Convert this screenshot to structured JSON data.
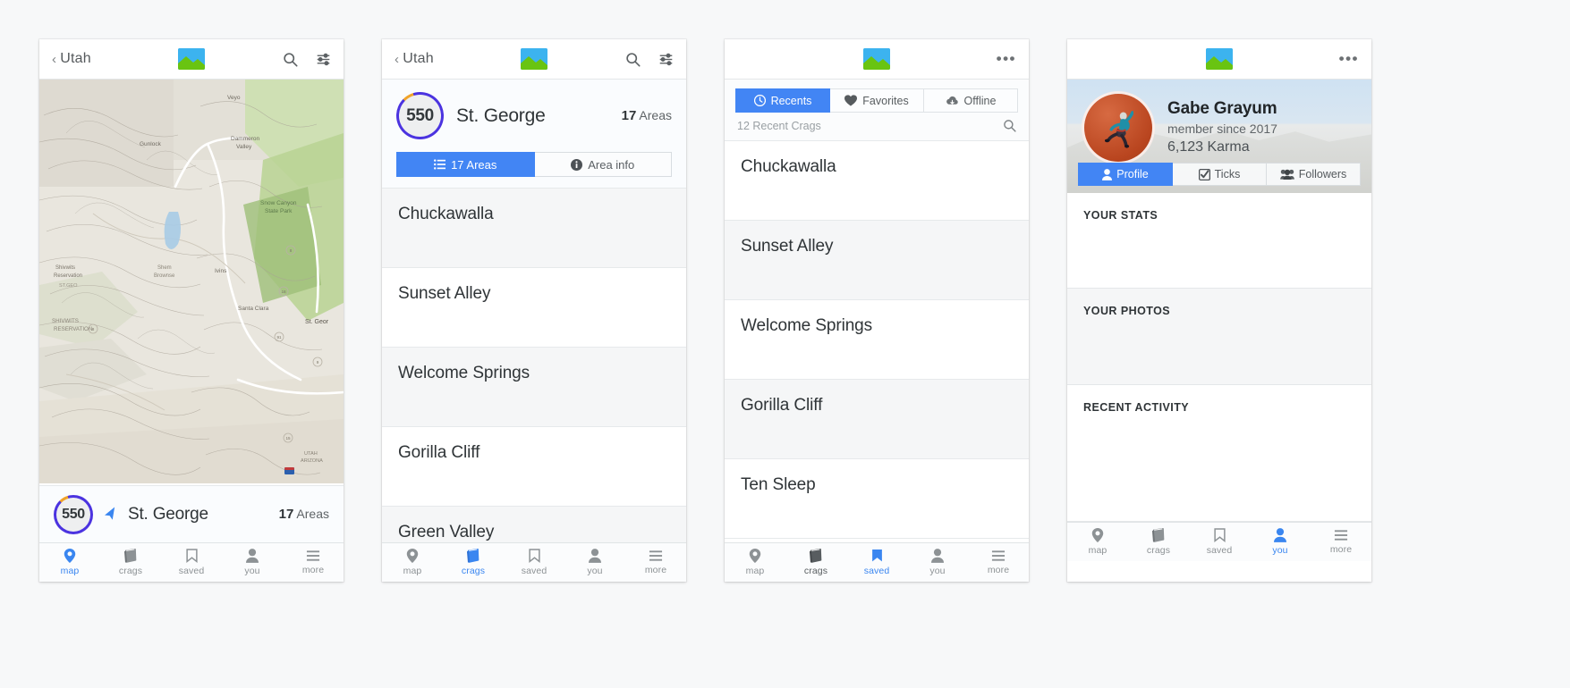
{
  "app": {
    "logo_name": "mountain-logo"
  },
  "panel_map": {
    "nav": {
      "back_label": "Utah",
      "search_icon": "search-icon",
      "filter_icon": "sliders-icon"
    },
    "map": {
      "labels": [
        "Veyo",
        "Dammeron Valley",
        "Gunlock",
        "Snow Canyon State Park",
        "Shivwits Reservation",
        "Ivins",
        "Santa Clara",
        "St. George",
        "UTAH",
        "ARIZONA"
      ]
    },
    "card": {
      "score": "550",
      "title": "St. George",
      "count": "17",
      "count_label": "Areas",
      "location_icon": "location-arrow-icon"
    },
    "tabs": [
      {
        "label": "map",
        "icon": "map-pin-icon",
        "active": true
      },
      {
        "label": "crags",
        "icon": "book-icon",
        "active": false
      },
      {
        "label": "saved",
        "icon": "bookmark-icon",
        "active": false
      },
      {
        "label": "you",
        "icon": "person-icon",
        "active": false
      },
      {
        "label": "more",
        "icon": "hamburger-icon",
        "active": false
      }
    ]
  },
  "panel_area": {
    "nav": {
      "back_label": "Utah",
      "search_icon": "search-icon",
      "filter_icon": "sliders-icon"
    },
    "header": {
      "score": "550",
      "title": "St. George",
      "count": "17",
      "count_label": "Areas"
    },
    "segments": [
      {
        "label": "17 Areas",
        "icon": "list-icon",
        "active": true
      },
      {
        "label": "Area info",
        "icon": "info-icon",
        "active": false
      }
    ],
    "list": [
      "Chuckawalla",
      "Sunset Alley",
      "Welcome Springs",
      "Gorilla Cliff",
      "Green Valley"
    ],
    "tabs": [
      {
        "label": "map",
        "icon": "map-pin-icon",
        "active": false
      },
      {
        "label": "crags",
        "icon": "book-icon",
        "active": true
      },
      {
        "label": "saved",
        "icon": "bookmark-icon",
        "active": false
      },
      {
        "label": "you",
        "icon": "person-icon",
        "active": false
      },
      {
        "label": "more",
        "icon": "hamburger-icon",
        "active": false
      }
    ]
  },
  "panel_saved": {
    "nav": {
      "menu_icon": "more-dots-icon"
    },
    "tabs": [
      {
        "label": "Recents",
        "icon": "clock-icon",
        "active": true
      },
      {
        "label": "Favorites",
        "icon": "heart-icon",
        "active": false
      },
      {
        "label": "Offline",
        "icon": "cloud-download-icon",
        "active": false
      }
    ],
    "search": {
      "value": "12 Recent Crags",
      "placeholder": "12 Recent Crags",
      "icon": "search-icon"
    },
    "list": [
      "Chuckawalla",
      "Sunset Alley",
      "Welcome Springs",
      "Gorilla Cliff",
      "Ten Sleep"
    ],
    "bottom_tabs": [
      {
        "label": "map",
        "icon": "map-pin-icon",
        "active": false
      },
      {
        "label": "crags",
        "icon": "book-icon",
        "active": false
      },
      {
        "label": "saved",
        "icon": "bookmark-icon",
        "active": true
      },
      {
        "label": "you",
        "icon": "person-icon",
        "active": false
      },
      {
        "label": "more",
        "icon": "hamburger-icon",
        "active": false
      }
    ]
  },
  "panel_profile": {
    "nav": {
      "menu_icon": "more-dots-icon"
    },
    "user": {
      "name": "Gabe Grayum",
      "member_since": "member since 2017",
      "karma": "6,123 Karma",
      "avatar_name": "user-avatar"
    },
    "tabs": [
      {
        "label": "Profile",
        "icon": "person-icon",
        "active": true
      },
      {
        "label": "Ticks",
        "icon": "check-square-icon",
        "active": false
      },
      {
        "label": "Followers",
        "icon": "people-icon",
        "active": false
      }
    ],
    "sections": [
      "YOUR STATS",
      "YOUR PHOTOS",
      "RECENT ACTIVITY"
    ],
    "bottom_tabs": [
      {
        "label": "map",
        "icon": "map-pin-icon",
        "active": false
      },
      {
        "label": "crags",
        "icon": "book-icon",
        "active": false
      },
      {
        "label": "saved",
        "icon": "bookmark-icon",
        "active": false
      },
      {
        "label": "you",
        "icon": "person-icon",
        "active": true
      },
      {
        "label": "more",
        "icon": "hamburger-icon",
        "active": false
      }
    ]
  },
  "colors": {
    "accent": "#4285f4",
    "active_tab": "#3a86f0",
    "ring": "#4b33e0",
    "ring_accent": "#f0a32a",
    "logo_sky": "#3cb3ef",
    "logo_hill": "#69c411"
  }
}
